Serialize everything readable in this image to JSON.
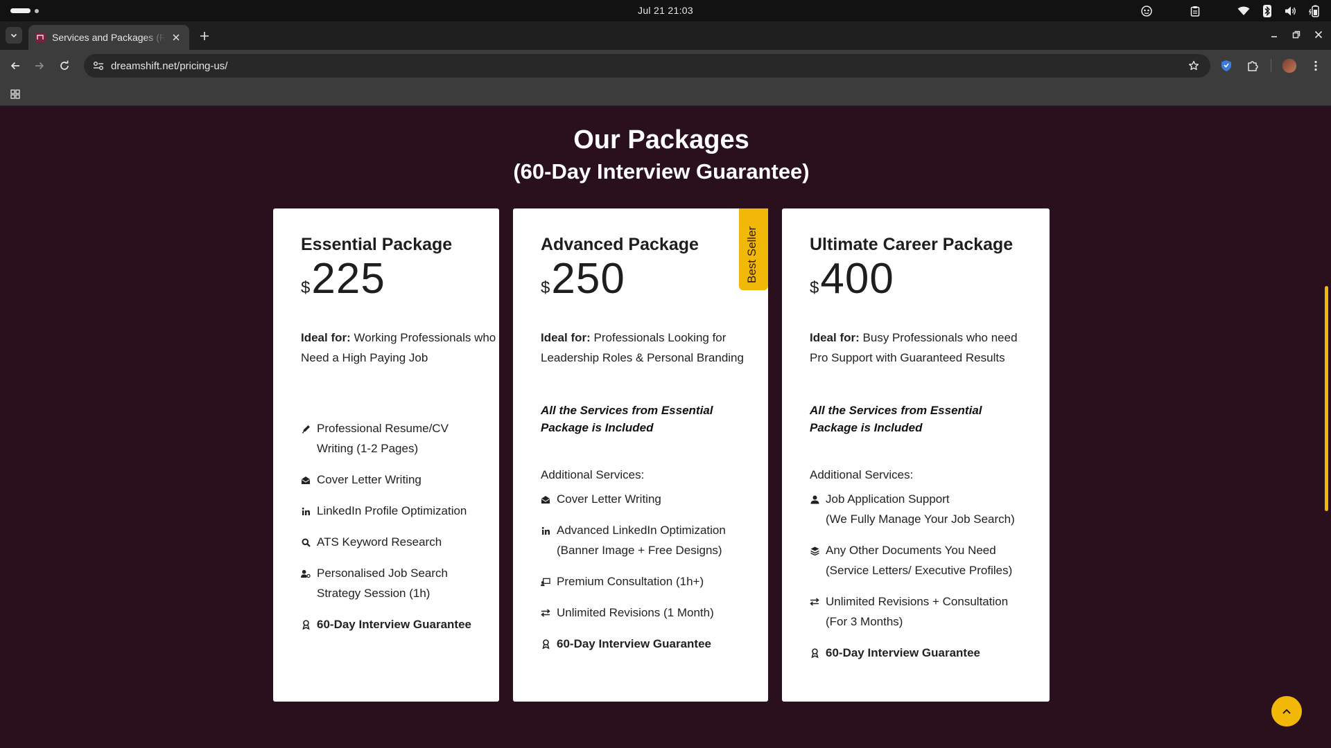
{
  "os": {
    "clock": "Jul 21  21:03"
  },
  "browser": {
    "tab_title": "Services and Packages (R",
    "url": "dreamshift.net/pricing-us/"
  },
  "page": {
    "title": "Our Packages",
    "subtitle": "(60-Day Interview Guarantee)",
    "ribbon": "Best Seller",
    "packages": [
      {
        "name": "Essential Package",
        "currency": "$",
        "price": "225",
        "ideal_label": "Ideal for:",
        "ideal_text": "Working Professionals who Need a High Paying Job",
        "features": [
          {
            "icon": "pen-icon",
            "text": "Professional Resume/CV",
            "text2": "Writing (1-2 Pages)"
          },
          {
            "icon": "envelope-icon",
            "text": "Cover Letter Writing"
          },
          {
            "icon": "linkedin-icon",
            "text": "LinkedIn Profile Optimization"
          },
          {
            "icon": "search-icon",
            "text": "ATS Keyword Research"
          },
          {
            "icon": "user-cog-icon",
            "text": "Personalised Job Search",
            "text2": "Strategy Session (1h)"
          },
          {
            "icon": "award-icon",
            "text": "60-Day Interview Guarantee"
          }
        ]
      },
      {
        "name": "Advanced Package",
        "currency": "$",
        "price": "250",
        "ideal_label": "Ideal for:",
        "ideal_text": "Professionals Looking for Leadership Roles & Personal Branding",
        "included_line1": "All the Services from Essential",
        "included_line2": "Package is Included",
        "additional_label": "Additional Services:",
        "features": [
          {
            "icon": "envelope-icon",
            "text": "Cover Letter Writing"
          },
          {
            "icon": "linkedin-icon",
            "text": "Advanced LinkedIn Optimization",
            "text2": "(Banner Image + Free Designs)"
          },
          {
            "icon": "chalkboard-user-icon",
            "text": "Premium Consultation (1h+)"
          },
          {
            "icon": "arrows-exchange-icon",
            "text": "Unlimited Revisions (1 Month)"
          },
          {
            "icon": "award-icon",
            "text": "60-Day Interview Guarantee"
          }
        ]
      },
      {
        "name": "Ultimate Career Package",
        "currency": "$",
        "price": "400",
        "ideal_label": "Ideal for:",
        "ideal_text": "Busy Professionals who need Pro Support with Guaranteed Results",
        "included_line1": "All the Services from Essential",
        "included_line2": "Package is Included",
        "additional_label": "Additional Services:",
        "features": [
          {
            "icon": "user-icon",
            "text": "Job Application Support",
            "text2": "(We Fully Manage Your Job Search)"
          },
          {
            "icon": "layers-icon",
            "text": "Any Other Documents You Need",
            "text2": "(Service Letters/ Executive Profiles)"
          },
          {
            "icon": "arrows-exchange-icon",
            "text": "Unlimited Revisions + Consultation",
            "text2": "(For 3 Months)"
          },
          {
            "icon": "award-icon",
            "text": "60-Day Interview Guarantee"
          }
        ]
      }
    ]
  },
  "colors": {
    "background": "#2a0f1c",
    "accent": "#f2b807",
    "card": "#ffffff"
  }
}
